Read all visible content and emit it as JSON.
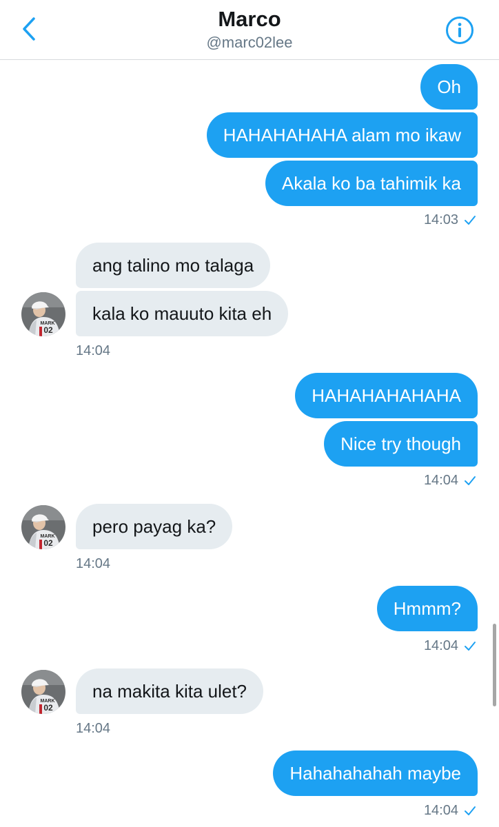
{
  "header": {
    "title": "Marco",
    "handle": "@marc02lee",
    "back_icon": "chevron-left-icon",
    "info_icon": "info-icon"
  },
  "colors": {
    "accent": "#1da1f2",
    "incoming_bubble": "#e6ecf0",
    "muted_text": "#657786"
  },
  "messages": [
    {
      "dir": "out",
      "text": "Oh"
    },
    {
      "dir": "out",
      "text": "HAHAHAHAHA alam mo ikaw"
    },
    {
      "dir": "out",
      "text": "Akala ko ba tahimik ka"
    },
    {
      "dir": "out_time",
      "text": "14:03"
    },
    {
      "dir": "in",
      "text": "ang talino mo talaga"
    },
    {
      "dir": "in",
      "text": "kala ko mauuto kita eh"
    },
    {
      "dir": "in_time",
      "text": "14:04"
    },
    {
      "dir": "out",
      "text": "HAHAHAHAHAHA"
    },
    {
      "dir": "out",
      "text": "Nice try though"
    },
    {
      "dir": "out_time",
      "text": "14:04"
    },
    {
      "dir": "in",
      "text": "pero payag ka?"
    },
    {
      "dir": "in_time",
      "text": "14:04"
    },
    {
      "dir": "out",
      "text": "Hmmm?"
    },
    {
      "dir": "out_time",
      "text": "14:04"
    },
    {
      "dir": "in",
      "text": "na makita kita ulet?"
    },
    {
      "dir": "in_time",
      "text": "14:04"
    },
    {
      "dir": "out",
      "text": "Hahahahahah maybe"
    },
    {
      "dir": "out_time",
      "text": "14:04"
    }
  ],
  "avatar_jersey": {
    "name": "MARK",
    "number": "02"
  }
}
